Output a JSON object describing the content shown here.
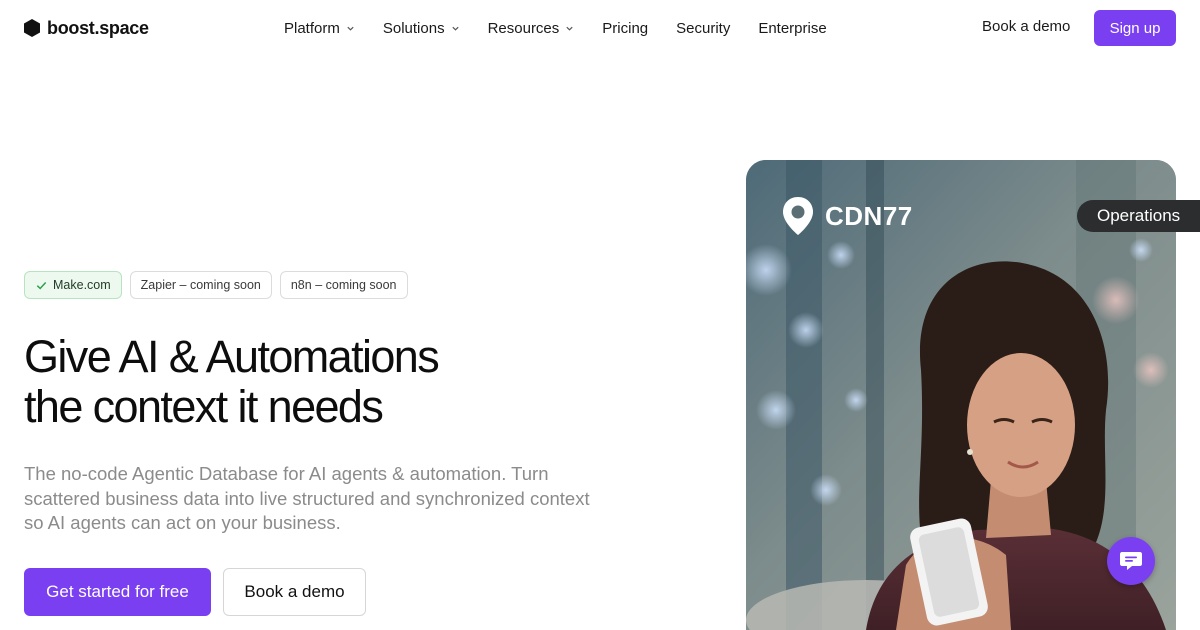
{
  "nav": {
    "logo_text": "boost.space",
    "items": [
      {
        "label": "Platform",
        "has_dropdown": true
      },
      {
        "label": "Solutions",
        "has_dropdown": true
      },
      {
        "label": "Resources",
        "has_dropdown": true
      },
      {
        "label": "Pricing",
        "has_dropdown": false
      },
      {
        "label": "Security",
        "has_dropdown": false
      },
      {
        "label": "Enterprise",
        "has_dropdown": false
      }
    ],
    "book_demo": "Book a demo",
    "signup": "Sign up"
  },
  "chips": [
    {
      "label": "Make.com",
      "active": true,
      "icon": "check-icon"
    },
    {
      "label": "Zapier – coming soon",
      "active": false
    },
    {
      "label": "n8n – coming soon",
      "active": false
    }
  ],
  "hero": {
    "headline_line1": "Give AI & Automations",
    "headline_line2": "the context it needs",
    "subtitle": "The no-code Agentic Database for AI agents & automation. Turn scattered business data into live structured and synchronized context so AI agents can act on your business.",
    "cta_primary": "Get started for free",
    "cta_secondary": "Book a demo"
  },
  "testimonial_card": {
    "brand_name": "CDN77",
    "brand_icon": "location-pin-icon",
    "tag": "Operations"
  },
  "chat_widget": {
    "icon": "chat-icon"
  },
  "colors": {
    "accent": "#7b3ff2",
    "chip_active_bg": "#edf9ef",
    "chip_active_check": "#2e9e4a",
    "pill_bg": "#2b2d2f"
  }
}
